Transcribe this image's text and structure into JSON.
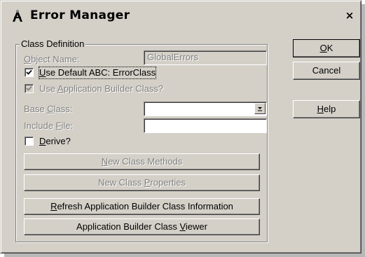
{
  "window": {
    "title": "Error Manager",
    "close_glyph": "×"
  },
  "group": {
    "legend": "Class Definition"
  },
  "fields": {
    "object_name": {
      "label_pre": "",
      "label_u": "O",
      "label_post": "bject Name:",
      "value": "GlobalErrors"
    },
    "use_default_abc": {
      "label_pre": "",
      "label_u": "U",
      "label_post": "se Default ABC: ErrorClass",
      "checked": true
    },
    "use_app_builder": {
      "label_pre": "Use ",
      "label_u": "A",
      "label_post": "pplication Builder Class?",
      "checked": true
    },
    "base_class": {
      "label_pre": "Base ",
      "label_u": "C",
      "label_post": "lass:",
      "value": ""
    },
    "include_file": {
      "label_pre": "Include ",
      "label_u": "F",
      "label_post": "ile:",
      "value": ""
    },
    "derive": {
      "label_pre": "",
      "label_u": "D",
      "label_post": "erive?",
      "checked": false
    }
  },
  "buttons": {
    "new_class_methods": {
      "pre": "",
      "u": "N",
      "post": "ew Class Methods"
    },
    "new_class_properties": {
      "pre": "New Class ",
      "u": "P",
      "post": "roperties"
    },
    "refresh": {
      "pre": "",
      "u": "R",
      "post": "efresh Application Builder Class Information"
    },
    "viewer": {
      "pre": "Application Builder Class ",
      "u": "V",
      "post": "iewer"
    },
    "ok": {
      "pre": "",
      "u": "O",
      "post": "K"
    },
    "cancel": {
      "pre": "Cancel",
      "u": "",
      "post": ""
    },
    "help": {
      "pre": "",
      "u": "H",
      "post": "elp"
    }
  },
  "icons": {
    "app": "clarion-app-icon",
    "close": "close-icon",
    "dropdown": "chevron-down-icon",
    "check": "checkmark-icon"
  }
}
